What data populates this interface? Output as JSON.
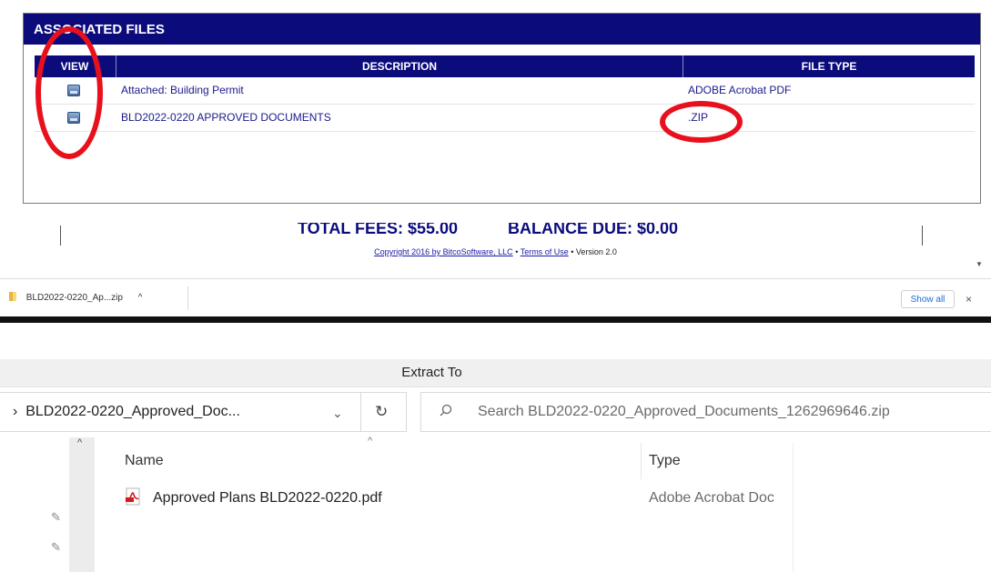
{
  "associated_files": {
    "title": "ASSOCIATED FILES",
    "columns": [
      "VIEW",
      "DESCRIPTION",
      "FILE TYPE"
    ],
    "rows": [
      {
        "description": "Attached: Building Permit",
        "file_type": "ADOBE Acrobat PDF"
      },
      {
        "description": "BLD2022-0220 APPROVED DOCUMENTS",
        "file_type": ".ZIP"
      }
    ]
  },
  "footer": {
    "total_fees": "TOTAL FEES: $55.00",
    "balance_due": "BALANCE DUE: $0.00",
    "copyright": "Copyright 2016 by BitcoSoftware, LLC",
    "terms": "Terms of Use",
    "version": "Version 2.0",
    "bullet": "•"
  },
  "download_bar": {
    "file_label": "BLD2022-0220_Ap...zip",
    "chevron": "^",
    "show_all": "Show all",
    "close": "×"
  },
  "explorer": {
    "window_title": "Extract To",
    "address": "BLD2022-0220_Approved_Doc...",
    "address_prefix": "›",
    "dropdown": "⌄",
    "refresh": "↻",
    "search_placeholder": "Search BLD2022-0220_Approved_Documents_1262969646.zip",
    "columns": {
      "name": "Name",
      "type": "Type"
    },
    "sort_indicator": "^",
    "nav_up": "^",
    "pin": "📌",
    "files": [
      {
        "name": "Approved Plans BLD2022-0220.pdf",
        "type": "Adobe Acrobat Doc"
      }
    ]
  },
  "colors": {
    "navy_header": "#0b0b7c",
    "link_blue": "#1a1a8c",
    "annotation_red": "#e8101d"
  }
}
